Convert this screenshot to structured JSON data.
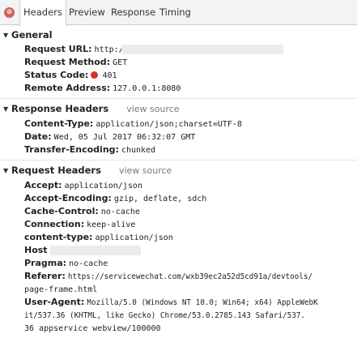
{
  "tabs": {
    "close_icon": "⊗",
    "items": [
      "Headers",
      "Preview",
      "Response",
      "Timing"
    ]
  },
  "general": {
    "title": "General",
    "request_url_key": "Request URL:",
    "request_url_value": "http:/",
    "request_method_key": "Request Method:",
    "request_method_value": "GET",
    "status_code_key": "Status Code:",
    "status_code_value": "401",
    "status_color": "#d93025",
    "remote_address_key": "Remote Address:",
    "remote_address_value": "127.0.0.1:8080"
  },
  "response_headers": {
    "title": "Response Headers",
    "view_source": "view source",
    "rows": [
      {
        "key": "Content-Type:",
        "value": "application/json;charset=UTF-8"
      },
      {
        "key": "Date:",
        "value": "Wed, 05 Jul 2017 06:32:07 GMT"
      },
      {
        "key": "Transfer-Encoding:",
        "value": "chunked"
      }
    ]
  },
  "request_headers": {
    "title": "Request Headers",
    "view_source": "view source",
    "rows": [
      {
        "key": "Accept:",
        "value": "application/json"
      },
      {
        "key": "Accept-Encoding:",
        "value": "gzip, deflate, sdch"
      },
      {
        "key": "Cache-Control:",
        "value": "no-cache"
      },
      {
        "key": "Connection:",
        "value": "keep-alive"
      },
      {
        "key": "content-type:",
        "value": "application/json"
      },
      {
        "key": "Host",
        "value": ""
      },
      {
        "key": "Pragma:",
        "value": "no-cache"
      },
      {
        "key": "Referer:",
        "value": "https://servicewechat.com/wxb39ec2a52d5cd91a/devtools/"
      },
      {
        "key": "",
        "value": "page-frame.html"
      },
      {
        "key": "User-Agent:",
        "value": "Mozilla/5.0 (Windows NT 10.0; Win64; x64) AppleWebK"
      },
      {
        "key": "",
        "value": "it/537.36 (KHTML, like Gecko) Chrome/53.0.2785.143 Safari/537."
      },
      {
        "key": "",
        "value": "36 appservice webview/100000"
      }
    ]
  }
}
